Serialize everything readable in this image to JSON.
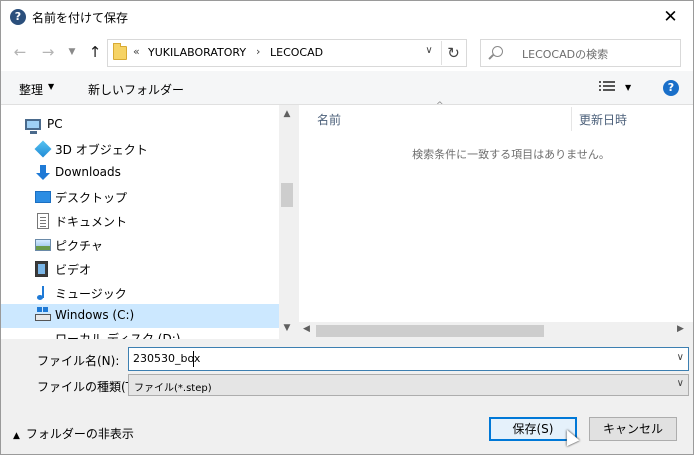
{
  "window": {
    "title": "名前を付けて保存",
    "close_label": "✕"
  },
  "address_bar": {
    "overflow": "«",
    "crumbs": [
      "YUKILABORATORY",
      "LECOCAD"
    ],
    "separator": "›"
  },
  "search": {
    "placeholder": "LECOCADの検索"
  },
  "toolbar": {
    "organize_label": "整理",
    "new_folder_label": "新しいフォルダー"
  },
  "nav": {
    "items": [
      {
        "label": "PC",
        "icon": "pc-icon"
      },
      {
        "label": "3D オブジェクト",
        "icon": "3d-objects-icon"
      },
      {
        "label": "Downloads",
        "icon": "downloads-icon"
      },
      {
        "label": "デスクトップ",
        "icon": "desktop-icon"
      },
      {
        "label": "ドキュメント",
        "icon": "documents-icon"
      },
      {
        "label": "ピクチャ",
        "icon": "pictures-icon"
      },
      {
        "label": "ビデオ",
        "icon": "videos-icon"
      },
      {
        "label": "ミュージック",
        "icon": "music-icon"
      },
      {
        "label": "Windows (C:)",
        "icon": "drive-icon",
        "selected": true
      }
    ],
    "partial_item": "ローカル ディスク (D:)"
  },
  "file_list": {
    "columns": [
      "名前",
      "更新日時"
    ],
    "empty_message": "検索条件に一致する項目はありません。"
  },
  "form": {
    "filename_label": "ファイル名(N):",
    "filename_value": "230530_box",
    "filetype_label": "ファイルの種類(T):",
    "filetype_value": "ファイル(*.step)"
  },
  "footer": {
    "hide_folders_label": "フォルダーの非表示",
    "save_label": "保存(S)",
    "cancel_label": "キャンセル"
  },
  "colors": {
    "accent": "#0078d7",
    "selected_bg": "#cce8ff",
    "help_icon": "#1a6fc9"
  }
}
